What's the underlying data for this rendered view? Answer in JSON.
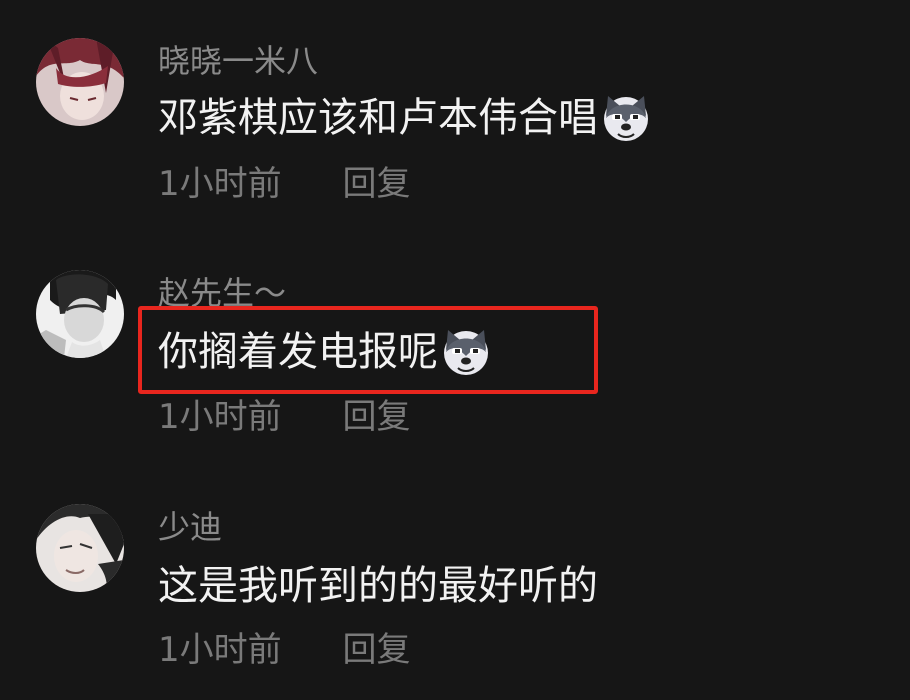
{
  "comments": [
    {
      "username": "晓晓一米八",
      "text": "邓紫棋应该和卢本伟合唱",
      "emoji": "husky-emoji",
      "time": "1小时前",
      "reply": "回复",
      "avatar": "avatar-anime-red-hair"
    },
    {
      "username": "赵先生～",
      "text": "你搁着发电报呢",
      "emoji": "husky-emoji",
      "time": "1小时前",
      "reply": "回复",
      "avatar": "avatar-monochrome-man",
      "highlighted": true
    },
    {
      "username": "少迪",
      "text": "这是我听到的的最好听的",
      "emoji": "",
      "time": "1小时前",
      "reply": "回复",
      "avatar": "avatar-anime-dark-hair"
    }
  ],
  "colors": {
    "background": "#161616",
    "username": "#8a8a8a",
    "text": "#f2f2f2",
    "meta": "#7a7a7a",
    "highlight": "#e8261e"
  }
}
